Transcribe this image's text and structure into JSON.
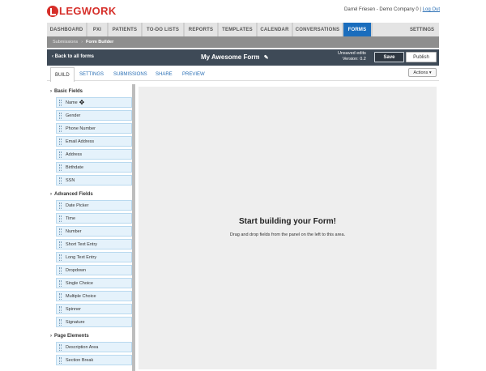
{
  "brand": {
    "logo_text": "LEGWORK",
    "accent": "#d62f2a"
  },
  "user": {
    "name": "Darrel Friesen - Demo Company 0",
    "separator": "|",
    "logout": "Log Out"
  },
  "nav": {
    "tabs": [
      {
        "label": "DASHBOARD"
      },
      {
        "label": "PXI"
      },
      {
        "label": "PATIENTS"
      },
      {
        "label": "TO-DO LISTS"
      },
      {
        "label": "REPORTS"
      },
      {
        "label": "TEMPLATES"
      },
      {
        "label": "CALENDAR"
      },
      {
        "label": "CONVERSATIONS"
      },
      {
        "label": "FORMS"
      }
    ],
    "active": "FORMS",
    "settings": "SETTINGS",
    "active_color": "#1a6dbd"
  },
  "breadcrumb": {
    "items": [
      "Submissions",
      "Form Builder"
    ],
    "separator": "›"
  },
  "formbar": {
    "back": "Back to all forms",
    "back_icon": "chevron-left-icon",
    "title": "My Awesome Form",
    "edit_icon": "pencil-icon",
    "unsaved_line1": "Unsaved edits",
    "unsaved_line2": "Version: 0.2",
    "save": "Save",
    "publish": "Publish"
  },
  "subtabs": {
    "items": [
      {
        "label": "BUILD"
      },
      {
        "label": "SETTINGS"
      },
      {
        "label": "SUBMISSIONS"
      },
      {
        "label": "SHARE"
      },
      {
        "label": "PREVIEW"
      }
    ],
    "active": "BUILD",
    "actions": "Actions ▾"
  },
  "sidebar": {
    "sections": [
      {
        "title": "Basic Fields",
        "fields": [
          "Name",
          "Gender",
          "Phone Number",
          "Email Address",
          "Address",
          "Birthdate",
          "SSN"
        ]
      },
      {
        "title": "Advanced Fields",
        "fields": [
          "Date Picker",
          "Time",
          "Number",
          "Short Text Entry",
          "Long Text Entry",
          "Dropdown",
          "Single Choice",
          "Multiple Choice",
          "Spinner",
          "Signature"
        ]
      },
      {
        "title": "Page Elements",
        "fields": [
          "Description Area",
          "Section Break"
        ]
      }
    ]
  },
  "canvas": {
    "title": "Start building your Form!",
    "subtitle": "Drag and drop fields from the panel on the left to this area."
  }
}
